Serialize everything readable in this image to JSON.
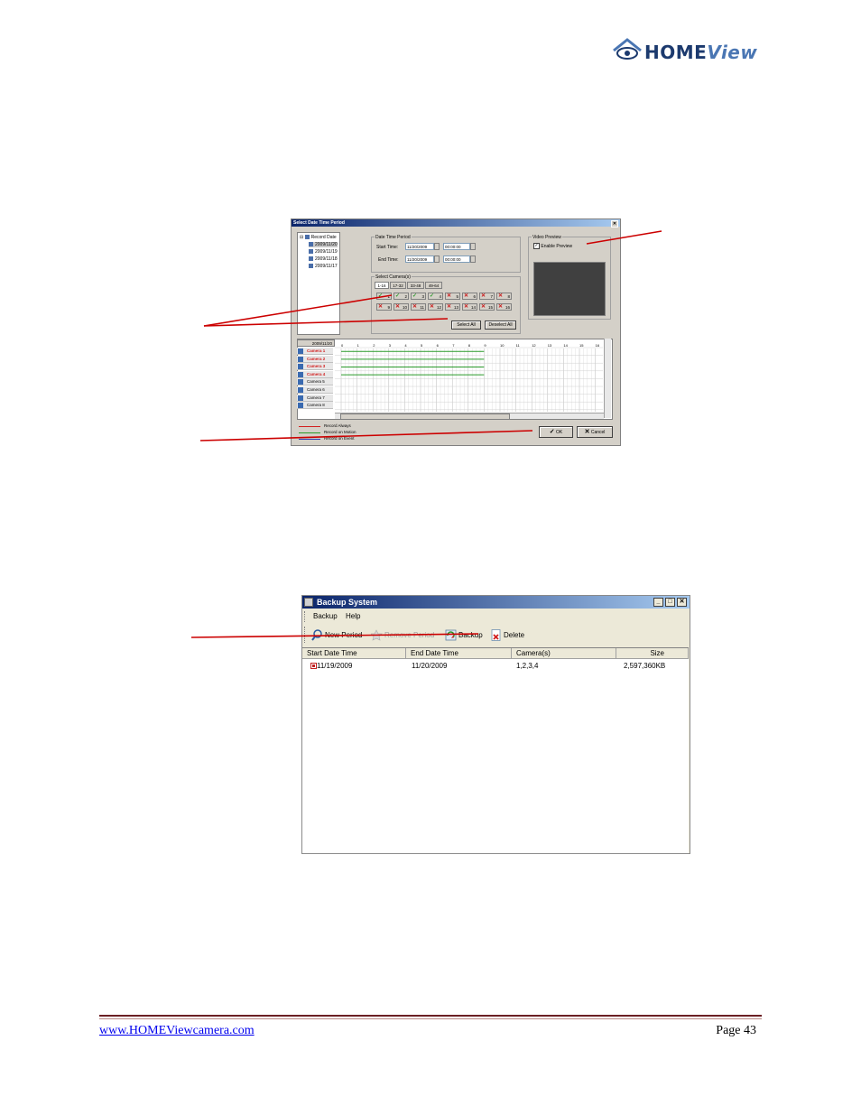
{
  "logo": {
    "home": "HOME",
    "view": "View"
  },
  "dialog1": {
    "title": "Select Date Time Period",
    "tree_root": "Record Date",
    "tree_dates": [
      "2009/11/20",
      "2009/11/19",
      "2009/11/18",
      "2009/11/17"
    ],
    "date_time_group": "Date Time Period",
    "start_label": "Start Time:",
    "start_date": "11/20/2009",
    "start_time": "00:00:00",
    "end_label": "End Time:",
    "end_date": "11/20/2009",
    "end_time": "00:00:00",
    "camera_group": "Select Camera(s)",
    "tabs": [
      "1-16",
      "17-32",
      "33-48",
      "49-64"
    ],
    "cameras_row1": [
      {
        "num": "1",
        "checked": true
      },
      {
        "num": "2",
        "checked": true
      },
      {
        "num": "3",
        "checked": true
      },
      {
        "num": "4",
        "checked": true
      },
      {
        "num": "5",
        "checked": false
      },
      {
        "num": "6",
        "checked": false
      },
      {
        "num": "7",
        "checked": false
      },
      {
        "num": "8",
        "checked": false
      }
    ],
    "cameras_row2": [
      {
        "num": "9",
        "checked": false
      },
      {
        "num": "10",
        "checked": false
      },
      {
        "num": "11",
        "checked": false
      },
      {
        "num": "12",
        "checked": false
      },
      {
        "num": "13",
        "checked": false
      },
      {
        "num": "14",
        "checked": false
      },
      {
        "num": "15",
        "checked": false
      },
      {
        "num": "16",
        "checked": false
      }
    ],
    "select_all": "Select All",
    "deselect_all": "Deselect All",
    "video_preview_group": "Video Preview",
    "enable_preview": "Enable Preview",
    "timeline_date": "2009/11/20",
    "hours": [
      "0",
      "1",
      "2",
      "3",
      "4",
      "5",
      "6",
      "7",
      "8",
      "9",
      "10",
      "11",
      "12",
      "13",
      "14",
      "15",
      "16"
    ],
    "camera_rows": [
      {
        "name": "Camera 1",
        "recorded": true
      },
      {
        "name": "Camera 2",
        "recorded": true
      },
      {
        "name": "Camera 3",
        "recorded": true
      },
      {
        "name": "Camera 4",
        "recorded": true
      },
      {
        "name": "Camera 5",
        "recorded": false
      },
      {
        "name": "Camera 6",
        "recorded": false
      },
      {
        "name": "Camera 7",
        "recorded": false
      },
      {
        "name": "Camera 8",
        "recorded": false
      }
    ],
    "legend": [
      {
        "label": "Record Always",
        "color": "#d21e1e"
      },
      {
        "label": "Record on Motion",
        "color": "#2a9a2a"
      },
      {
        "label": "Record on Event",
        "color": "#2a3ab0"
      }
    ],
    "ok": "OK",
    "cancel": "Cancel"
  },
  "dialog2": {
    "title": "Backup System",
    "menu": [
      "Backup",
      "Help"
    ],
    "toolbar": {
      "new_period": "New Period",
      "remove_period": "Remove Period",
      "backup": "Backup",
      "delete": "Delete"
    },
    "columns": [
      "Start Date Time",
      "End Date Time",
      "Camera(s)",
      "Size"
    ],
    "rows": [
      {
        "start": "11/19/2009",
        "end": "11/20/2009",
        "cameras": "1,2,3,4",
        "size": "2,597,360KB"
      }
    ]
  },
  "footer": {
    "url": "www.HOMEViewcamera.com",
    "page": "Page 43"
  },
  "colors": {
    "callout_arrow": "#cc0000",
    "footer_rule": "#6b1f24",
    "title_bar": "#0a246a"
  }
}
